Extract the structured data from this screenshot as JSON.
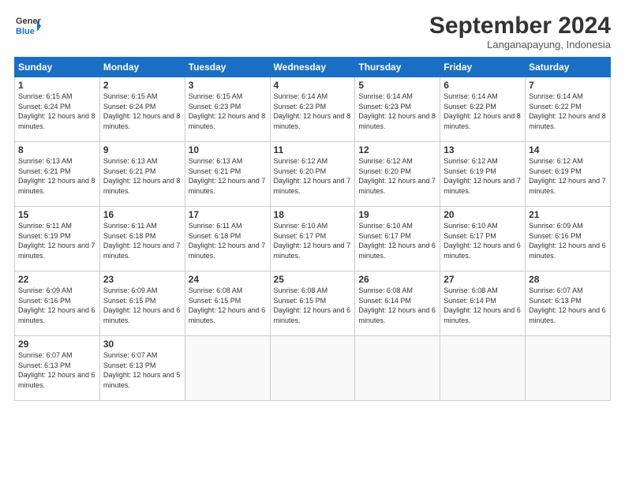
{
  "header": {
    "logo_line1": "General",
    "logo_line2": "Blue",
    "month": "September 2024",
    "location": "Langanapayung, Indonesia"
  },
  "days_of_week": [
    "Sunday",
    "Monday",
    "Tuesday",
    "Wednesday",
    "Thursday",
    "Friday",
    "Saturday"
  ],
  "weeks": [
    [
      {
        "day": "1",
        "sunrise": "6:15 AM",
        "sunset": "6:24 PM",
        "daylight": "12 hours and 8 minutes."
      },
      {
        "day": "2",
        "sunrise": "6:15 AM",
        "sunset": "6:24 PM",
        "daylight": "12 hours and 8 minutes."
      },
      {
        "day": "3",
        "sunrise": "6:15 AM",
        "sunset": "6:23 PM",
        "daylight": "12 hours and 8 minutes."
      },
      {
        "day": "4",
        "sunrise": "6:14 AM",
        "sunset": "6:23 PM",
        "daylight": "12 hours and 8 minutes."
      },
      {
        "day": "5",
        "sunrise": "6:14 AM",
        "sunset": "6:23 PM",
        "daylight": "12 hours and 8 minutes."
      },
      {
        "day": "6",
        "sunrise": "6:14 AM",
        "sunset": "6:22 PM",
        "daylight": "12 hours and 8 minutes."
      },
      {
        "day": "7",
        "sunrise": "6:14 AM",
        "sunset": "6:22 PM",
        "daylight": "12 hours and 8 minutes."
      }
    ],
    [
      {
        "day": "8",
        "sunrise": "6:13 AM",
        "sunset": "6:21 PM",
        "daylight": "12 hours and 8 minutes."
      },
      {
        "day": "9",
        "sunrise": "6:13 AM",
        "sunset": "6:21 PM",
        "daylight": "12 hours and 8 minutes."
      },
      {
        "day": "10",
        "sunrise": "6:13 AM",
        "sunset": "6:21 PM",
        "daylight": "12 hours and 7 minutes."
      },
      {
        "day": "11",
        "sunrise": "6:12 AM",
        "sunset": "6:20 PM",
        "daylight": "12 hours and 7 minutes."
      },
      {
        "day": "12",
        "sunrise": "6:12 AM",
        "sunset": "6:20 PM",
        "daylight": "12 hours and 7 minutes."
      },
      {
        "day": "13",
        "sunrise": "6:12 AM",
        "sunset": "6:19 PM",
        "daylight": "12 hours and 7 minutes."
      },
      {
        "day": "14",
        "sunrise": "6:12 AM",
        "sunset": "6:19 PM",
        "daylight": "12 hours and 7 minutes."
      }
    ],
    [
      {
        "day": "15",
        "sunrise": "6:11 AM",
        "sunset": "6:19 PM",
        "daylight": "12 hours and 7 minutes."
      },
      {
        "day": "16",
        "sunrise": "6:11 AM",
        "sunset": "6:18 PM",
        "daylight": "12 hours and 7 minutes."
      },
      {
        "day": "17",
        "sunrise": "6:11 AM",
        "sunset": "6:18 PM",
        "daylight": "12 hours and 7 minutes."
      },
      {
        "day": "18",
        "sunrise": "6:10 AM",
        "sunset": "6:17 PM",
        "daylight": "12 hours and 7 minutes."
      },
      {
        "day": "19",
        "sunrise": "6:10 AM",
        "sunset": "6:17 PM",
        "daylight": "12 hours and 6 minutes."
      },
      {
        "day": "20",
        "sunrise": "6:10 AM",
        "sunset": "6:17 PM",
        "daylight": "12 hours and 6 minutes."
      },
      {
        "day": "21",
        "sunrise": "6:09 AM",
        "sunset": "6:16 PM",
        "daylight": "12 hours and 6 minutes."
      }
    ],
    [
      {
        "day": "22",
        "sunrise": "6:09 AM",
        "sunset": "6:16 PM",
        "daylight": "12 hours and 6 minutes."
      },
      {
        "day": "23",
        "sunrise": "6:09 AM",
        "sunset": "6:15 PM",
        "daylight": "12 hours and 6 minutes."
      },
      {
        "day": "24",
        "sunrise": "6:08 AM",
        "sunset": "6:15 PM",
        "daylight": "12 hours and 6 minutes."
      },
      {
        "day": "25",
        "sunrise": "6:08 AM",
        "sunset": "6:15 PM",
        "daylight": "12 hours and 6 minutes."
      },
      {
        "day": "26",
        "sunrise": "6:08 AM",
        "sunset": "6:14 PM",
        "daylight": "12 hours and 6 minutes."
      },
      {
        "day": "27",
        "sunrise": "6:08 AM",
        "sunset": "6:14 PM",
        "daylight": "12 hours and 6 minutes."
      },
      {
        "day": "28",
        "sunrise": "6:07 AM",
        "sunset": "6:13 PM",
        "daylight": "12 hours and 6 minutes."
      }
    ],
    [
      {
        "day": "29",
        "sunrise": "6:07 AM",
        "sunset": "6:13 PM",
        "daylight": "12 hours and 6 minutes."
      },
      {
        "day": "30",
        "sunrise": "6:07 AM",
        "sunset": "6:13 PM",
        "daylight": "12 hours and 5 minutes."
      },
      null,
      null,
      null,
      null,
      null
    ]
  ]
}
